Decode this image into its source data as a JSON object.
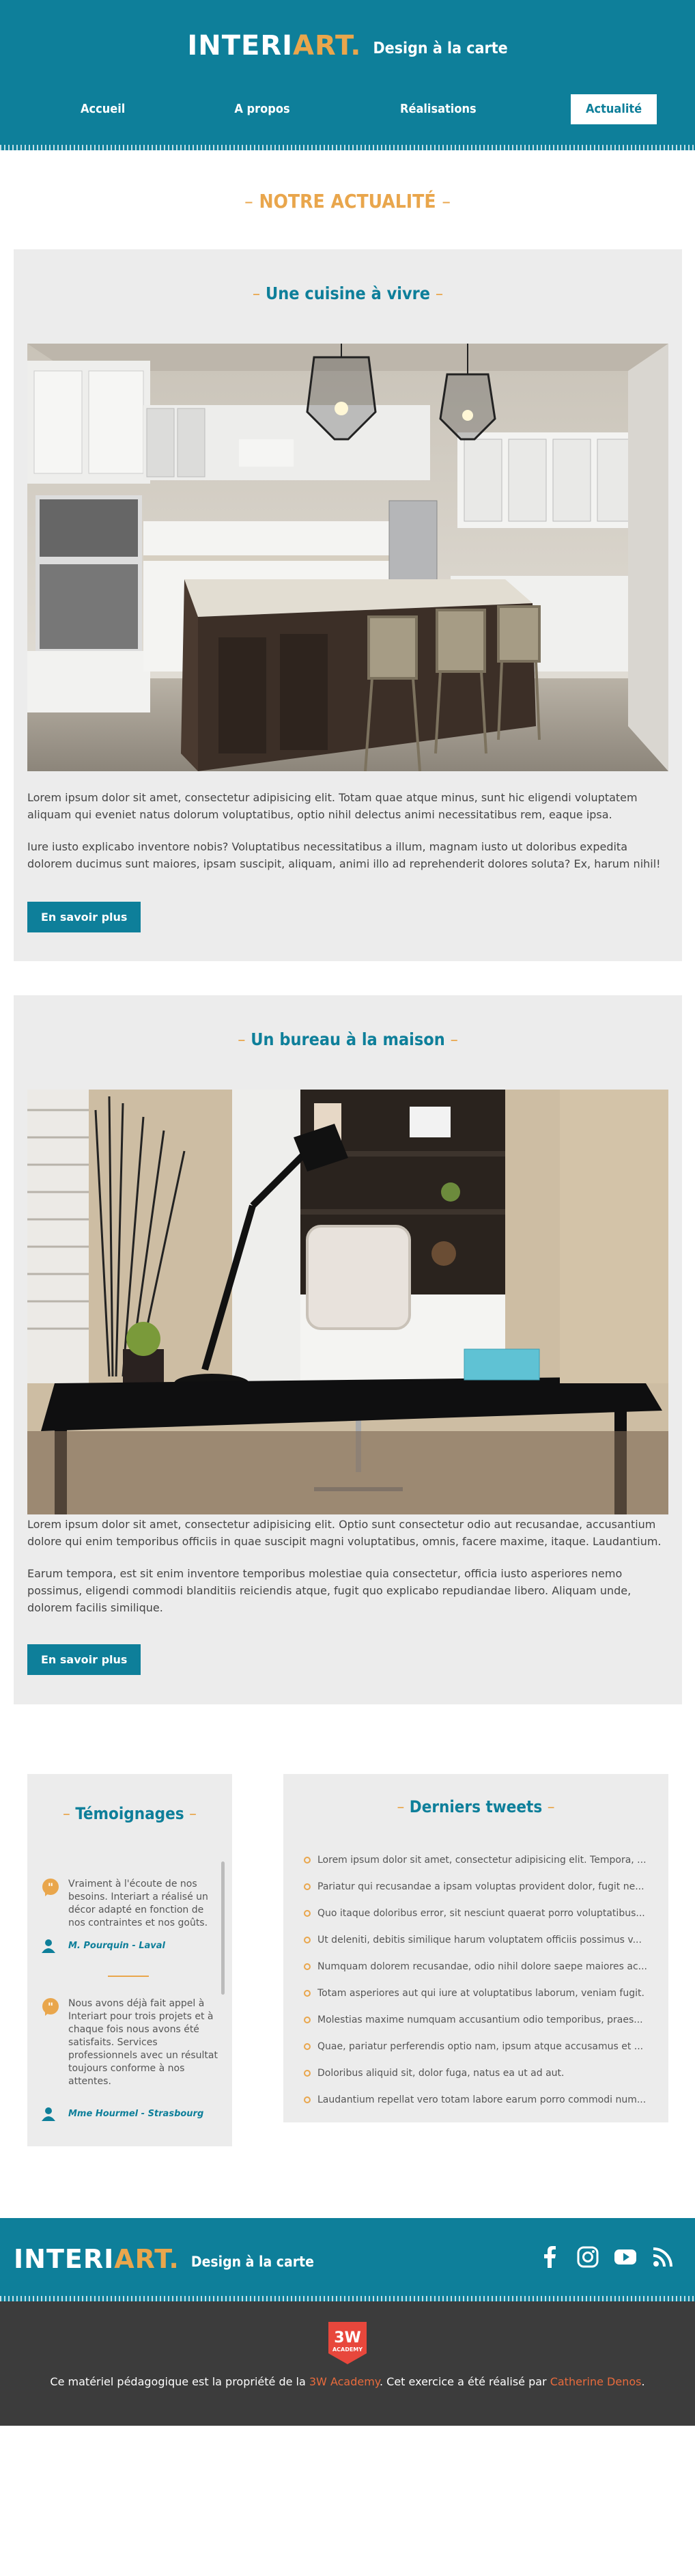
{
  "brand": {
    "logo_part1": "INTERI",
    "logo_part2": "ART",
    "logo_dot": ".",
    "tagline": "Design à la carte"
  },
  "nav": {
    "items": [
      "Accueil",
      "A propos",
      "Réalisations",
      "Actualité"
    ],
    "active": "Actualité"
  },
  "main_title": {
    "text": "NOTRE ACTUALITÉ",
    "dash": "–"
  },
  "articles": [
    {
      "title": "Une cuisine à vivre",
      "image_alt": "kitchen-photo",
      "paragraphs": [
        "Lorem ipsum dolor sit amet, consectetur adipisicing elit. Totam quae atque minus, sunt hic eligendi voluptatem aliquam qui eveniet natus dolorum voluptatibus, optio nihil delectus animi necessitatibus rem, eaque ipsa.",
        "Iure iusto explicabo inventore nobis? Voluptatibus necessitatibus a illum, magnam iusto ut doloribus expedita dolorem ducimus sunt maiores, ipsam suscipit, aliquam, animi illo ad reprehenderit dolores soluta? Ex, harum nihil!"
      ],
      "button": "En savoir plus"
    },
    {
      "title": "Un bureau à la maison",
      "image_alt": "office-photo",
      "paragraphs": [
        "Lorem ipsum dolor sit amet, consectetur adipisicing elit. Optio sunt consectetur odio aut recusandae, accusantium dolore qui enim temporibus officiis in quae suscipit magni voluptatibus, omnis, facere maxime, itaque. Laudantium.",
        "Earum tempora, est sit enim inventore temporibus molestiae quia consectetur, officia iusto asperiores nemo possimus, eligendi commodi blanditiis reiciendis atque, fugit quo explicabo repudiandae libero. Aliquam unde, dolorem facilis similique."
      ],
      "button": "En savoir plus"
    }
  ],
  "testimonials": {
    "title": "Témoignages",
    "items": [
      {
        "text": "Vraiment à l'écoute de nos besoins. Interiart a réalisé un décor adapté en fonction de nos contraintes et nos goûts.",
        "author": "M. Pourquin - Laval"
      },
      {
        "text": "Nous avons déjà fait appel à Interiart pour trois projets et à chaque fois nous avons été satisfaits. Services professionnels avec un résultat toujours conforme à nos attentes.",
        "author": "Mme Hourmel - Strasbourg"
      }
    ]
  },
  "tweets": {
    "title": "Derniers tweets",
    "items": [
      "Lorem ipsum dolor sit amet, consectetur adipisicing elit. Tempora, ...",
      "Pariatur qui recusandae a ipsam voluptas provident dolor, fugit ne...",
      "Quo itaque doloribus error, sit nesciunt quaerat porro voluptatibus...",
      "Ut deleniti, debitis similique harum voluptatem officiis possimus v...",
      "Numquam dolorem recusandae, odio nihil dolore saepe maiores ac...",
      "Totam asperiores aut qui iure at voluptatibus laborum, veniam fugit.",
      "Molestias maxime numquam accusantium odio temporibus, praes...",
      "Quae, pariatur perferendis optio nam, ipsum atque accusamus et ...",
      "Doloribus aliquid sit, dolor fuga, natus ea ut ad aut.",
      "Laudantium repellat vero totam labore earum porro commodi num..."
    ]
  },
  "footer": {
    "socials": [
      "facebook-icon",
      "instagram-icon",
      "youtube-icon",
      "rss-icon"
    ],
    "badge_top": "3W",
    "badge_bottom": "ACADEMY",
    "credits_prefix": "Ce matériel pédagogique est la propriété de la ",
    "credits_link1": "3W Academy",
    "credits_middle": ". Cet exercice a été réalisé par ",
    "credits_link2": "Catherine Denos",
    "credits_suffix": "."
  },
  "colors": {
    "primary": "#0e7f9a",
    "accent": "#e9a64c",
    "link": "#e86b3c",
    "panel": "#ececec",
    "footer_dark": "#3c3c3c"
  }
}
